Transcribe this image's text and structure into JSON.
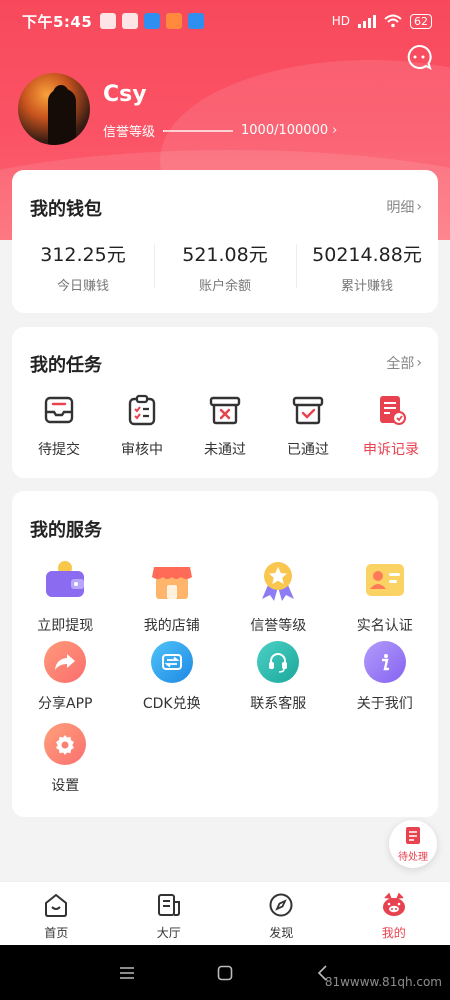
{
  "status_bar": {
    "time": "下午5:45",
    "network": "HD",
    "battery": "62"
  },
  "profile": {
    "name": "Csy",
    "credit_label": "信誉等级",
    "credit_value": "1000/100000",
    "credit_progress": 0.01
  },
  "wallet": {
    "title": "我的钱包",
    "more": "明细",
    "stats": [
      {
        "value": "312.25元",
        "label": "今日赚钱"
      },
      {
        "value": "521.08元",
        "label": "账户余额"
      },
      {
        "value": "50214.88元",
        "label": "累计赚钱"
      }
    ]
  },
  "tasks": {
    "title": "我的任务",
    "more": "全部",
    "items": [
      {
        "label": "待提交",
        "icon": "inbox-icon"
      },
      {
        "label": "审核中",
        "icon": "clipboard-checklist-icon"
      },
      {
        "label": "未通过",
        "icon": "box-x-icon"
      },
      {
        "label": "已通过",
        "icon": "box-check-icon"
      },
      {
        "label": "申诉记录",
        "icon": "document-appeal-icon"
      }
    ]
  },
  "services": {
    "title": "我的服务",
    "items": [
      {
        "label": "立即提现",
        "icon": "wallet-icon"
      },
      {
        "label": "我的店铺",
        "icon": "shop-icon"
      },
      {
        "label": "信誉等级",
        "icon": "medal-star-icon"
      },
      {
        "label": "实名认证",
        "icon": "id-card-icon"
      },
      {
        "label": "分享APP",
        "icon": "share-arrow-icon"
      },
      {
        "label": "CDK兑换",
        "icon": "exchange-icon"
      },
      {
        "label": "联系客服",
        "icon": "headset-icon"
      },
      {
        "label": "关于我们",
        "icon": "info-icon"
      },
      {
        "label": "设置",
        "icon": "gear-icon"
      }
    ]
  },
  "float_button": {
    "label": "待处理"
  },
  "tab_bar": {
    "items": [
      {
        "label": "首页",
        "icon": "home-face-icon"
      },
      {
        "label": "大厅",
        "icon": "hall-document-icon"
      },
      {
        "label": "发现",
        "icon": "compass-icon"
      },
      {
        "label": "我的",
        "icon": "pig-face-icon"
      }
    ],
    "active": "我的"
  },
  "watermark": "81wwww.81qh.com",
  "colors": {
    "brand_red": "#f8495c",
    "accent": "#e8414f",
    "background": "#f3f3f3"
  }
}
